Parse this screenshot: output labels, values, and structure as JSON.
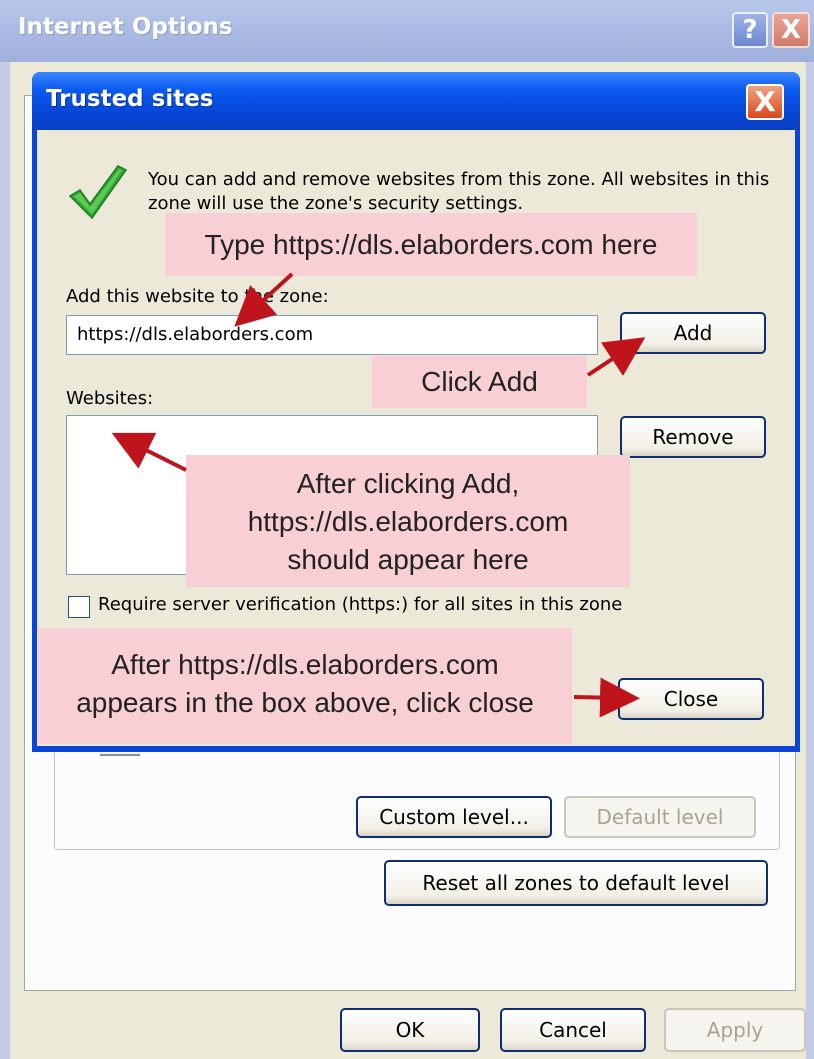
{
  "outer_window": {
    "title": "Internet Options",
    "help_glyph": "?",
    "close_glyph": "X",
    "buttons": {
      "custom_level": "Custom level...",
      "default_level": "Default level",
      "reset_all": "Reset all zones to default level",
      "ok": "OK",
      "cancel": "Cancel",
      "apply": "Apply"
    }
  },
  "dialog": {
    "title": "Trusted sites",
    "close_glyph": "X",
    "info_text": "You can add and remove websites from this zone. All websites in this zone will use the zone's security settings.",
    "add_label": "Add this website to the zone:",
    "site_input_value": "https://dls.elaborders.com",
    "add_button": "Add",
    "websites_label": "Websites:",
    "remove_button": "Remove",
    "require_verification_label": "Require server verification (https:) for all sites in this zone",
    "require_verification_checked": false,
    "close_button": "Close"
  },
  "annotations": {
    "type_here": "Type https://dls.elaborders.com here",
    "click_add": "Click Add",
    "after_add": [
      "After clicking Add,",
      "https://dls.elaborders.com",
      "should appear here"
    ],
    "after_close": [
      "After https://dls.elaborders.com",
      "appears in the box above, click close"
    ]
  },
  "colors": {
    "callout_bg": "#f7cfd5",
    "arrow": "#c0141c",
    "dialog_titlebar": "#0646d8",
    "dialog_body": "#ece9d8"
  },
  "icons": {
    "zone_icon": "green-checkmark-icon"
  }
}
